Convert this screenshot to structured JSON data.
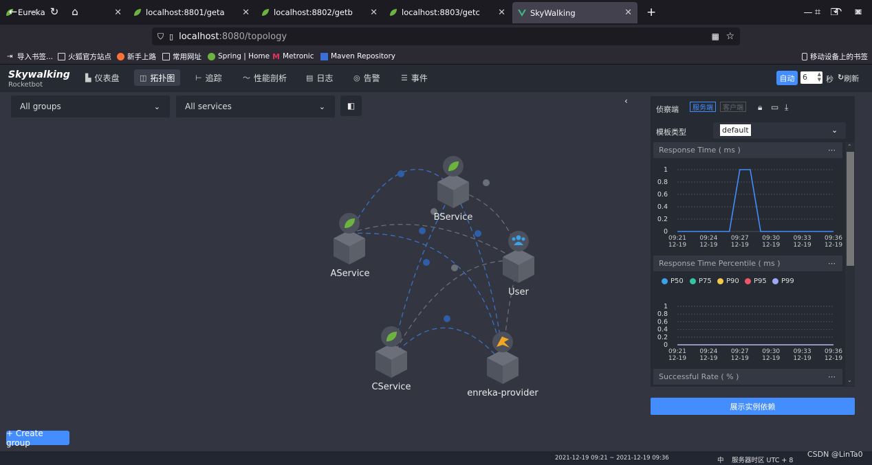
{
  "browser": {
    "tabs": [
      {
        "label": "Eureka"
      },
      {
        "label": "localhost:8801/geta"
      },
      {
        "label": "localhost:8802/getb"
      },
      {
        "label": "localhost:8803/getc"
      },
      {
        "label": "SkyWalking"
      }
    ],
    "new_tab": "+",
    "url_host": "localhost",
    "url_rest": ":8080/topology",
    "bookmarks": [
      {
        "label": "导入书签..."
      },
      {
        "label": "火狐官方站点"
      },
      {
        "label": "新手上路"
      },
      {
        "label": "常用网址"
      },
      {
        "label": "Spring | Home"
      },
      {
        "label": "Metronic"
      },
      {
        "label": "Maven Repository"
      }
    ],
    "mobile_bookmarks": "移动设备上的书签"
  },
  "app": {
    "logo": "Skywalking",
    "logo_sub": "Rocketbot",
    "menu": [
      {
        "label": "仪表盘",
        "icon": "dashboard-icon"
      },
      {
        "label": "拓扑图",
        "icon": "topology-icon"
      },
      {
        "label": "追踪",
        "icon": "trace-icon"
      },
      {
        "label": "性能剖析",
        "icon": "profile-icon"
      },
      {
        "label": "日志",
        "icon": "log-icon"
      },
      {
        "label": "告警",
        "icon": "alarm-icon"
      },
      {
        "label": "事件",
        "icon": "event-icon"
      }
    ],
    "auto_label": "自动",
    "interval_value": "6",
    "interval_unit": "秒",
    "refresh_label": "刷新"
  },
  "toolbar": {
    "groups_select": "All groups",
    "services_select": "All services"
  },
  "topology": {
    "nodes": [
      {
        "label": "BService"
      },
      {
        "label": "AService"
      },
      {
        "label": "User"
      },
      {
        "label": "CService"
      },
      {
        "label": "enreka-provider"
      }
    ]
  },
  "create_group": "+ Create group",
  "panel": {
    "title": "侦察端",
    "toggle_server": "服务端",
    "toggle_client": "客户端",
    "template_label": "模板类型",
    "template_value": "default",
    "cards": [
      {
        "title": "Response Time ( ms )"
      },
      {
        "title": "Response Time Percentile ( ms )"
      },
      {
        "title": "Successful Rate ( % )"
      }
    ],
    "legend": [
      "P50",
      "P75",
      "P90",
      "P95",
      "P99"
    ],
    "legend_colors": [
      "#3ba1e8",
      "#34c3a4",
      "#f2c94c",
      "#f0566a",
      "#9fa8f5"
    ],
    "y_ticks": [
      "1",
      "0.8",
      "0.6",
      "0.4",
      "0.2",
      "0"
    ],
    "x_times": [
      "09:21",
      "09:24",
      "09:27",
      "09:30",
      "09:33",
      "09:36"
    ],
    "x_date": "12-19",
    "show_instances": "展示实例依赖"
  },
  "chart_data": [
    {
      "type": "line",
      "title": "Response Time ( ms )",
      "x": [
        "09:21",
        "09:22",
        "09:23",
        "09:24",
        "09:25",
        "09:26",
        "09:27",
        "09:28",
        "09:29",
        "09:30",
        "09:31",
        "09:32",
        "09:33",
        "09:34",
        "09:35",
        "09:36"
      ],
      "values": [
        0,
        0,
        0,
        0,
        0,
        0,
        1,
        1,
        0,
        0,
        0,
        0,
        0,
        0,
        0,
        0
      ],
      "ylim": [
        0,
        1
      ],
      "color": "#448dfe"
    },
    {
      "type": "line",
      "title": "Response Time Percentile ( ms )",
      "x": [
        "09:21",
        "09:36"
      ],
      "series": [
        {
          "name": "P50",
          "values": [
            0,
            0
          ]
        },
        {
          "name": "P75",
          "values": [
            0,
            0
          ]
        },
        {
          "name": "P90",
          "values": [
            0,
            0
          ]
        },
        {
          "name": "P95",
          "values": [
            0,
            0
          ]
        },
        {
          "name": "P99",
          "values": [
            0,
            0
          ]
        }
      ],
      "ylim": [
        0,
        1
      ]
    }
  ],
  "footer": {
    "range": "2021-12-19 09:21 ~ 2021-12-19 09:36",
    "lang": "中",
    "timezone": "服务器时区 UTC + 8",
    "watermark": "CSDN @LinTa0"
  }
}
